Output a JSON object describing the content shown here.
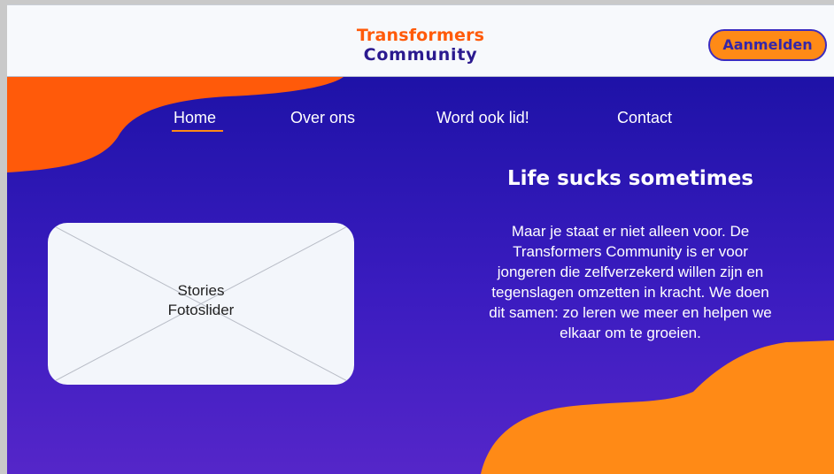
{
  "header": {
    "logo_line1": "Transformers",
    "logo_line2": "Community",
    "login_label": "Aanmelden"
  },
  "nav": {
    "items": [
      {
        "label": "Home",
        "active": true
      },
      {
        "label": "Over ons",
        "active": false
      },
      {
        "label": "Word ook lid!",
        "active": false
      },
      {
        "label": "Contact",
        "active": false
      }
    ]
  },
  "slider": {
    "line1": "Stories",
    "line2": "Fotoslider"
  },
  "hero": {
    "title": "Life sucks sometimes",
    "text": "Maar je staat er niet alleen voor. De Transformers Community is er voor jongeren die zelfverzekerd willen zijn en tegenslagen omzetten in kracht. We doen dit samen: zo leren we meer en helpen we elkaar om te groeien."
  },
  "colors": {
    "orange": "#ff8a16",
    "red_orange": "#ff5a0a",
    "indigo": "#2b1a8f",
    "hero_top": "#1e12a7",
    "hero_bottom": "#5526c9"
  }
}
